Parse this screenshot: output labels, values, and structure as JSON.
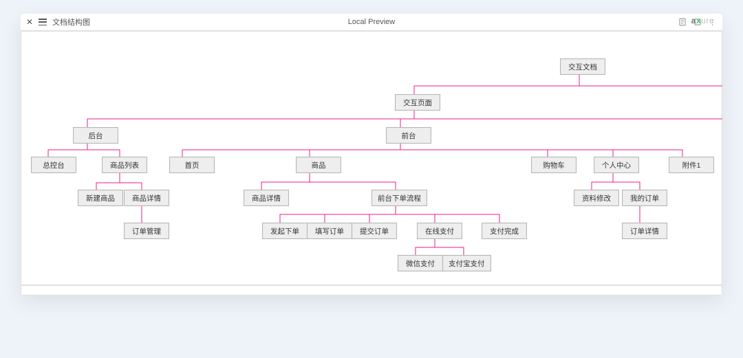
{
  "toolbar": {
    "title": "文档结构图",
    "center": "Local Preview"
  },
  "brand": {
    "a": "a",
    "x": "x",
    "ure": "ure"
  },
  "nodes": {
    "root": "交互文档",
    "pages": "交互页面",
    "backend": "后台",
    "frontend": "前台",
    "console": "总控台",
    "goods_list": "商品列表",
    "new_goods": "新建商品",
    "goods_detail_b": "商品详情",
    "order_mgmt": "订单管理",
    "home": "首页",
    "goods": "商品",
    "cart": "购物车",
    "profile": "个人中心",
    "attach": "附件1",
    "goods_detail_f": "商品详情",
    "order_flow": "前台下单流程",
    "profile_edit": "资料修改",
    "my_orders": "我的订单",
    "order_detail": "订单详情",
    "start_order": "发起下单",
    "fill_order": "填写订单",
    "submit_order": "提交订单",
    "pay_online": "在线支付",
    "pay_done": "支付完成",
    "wechat_pay": "微信支付",
    "alipay": "支付宝支付"
  }
}
